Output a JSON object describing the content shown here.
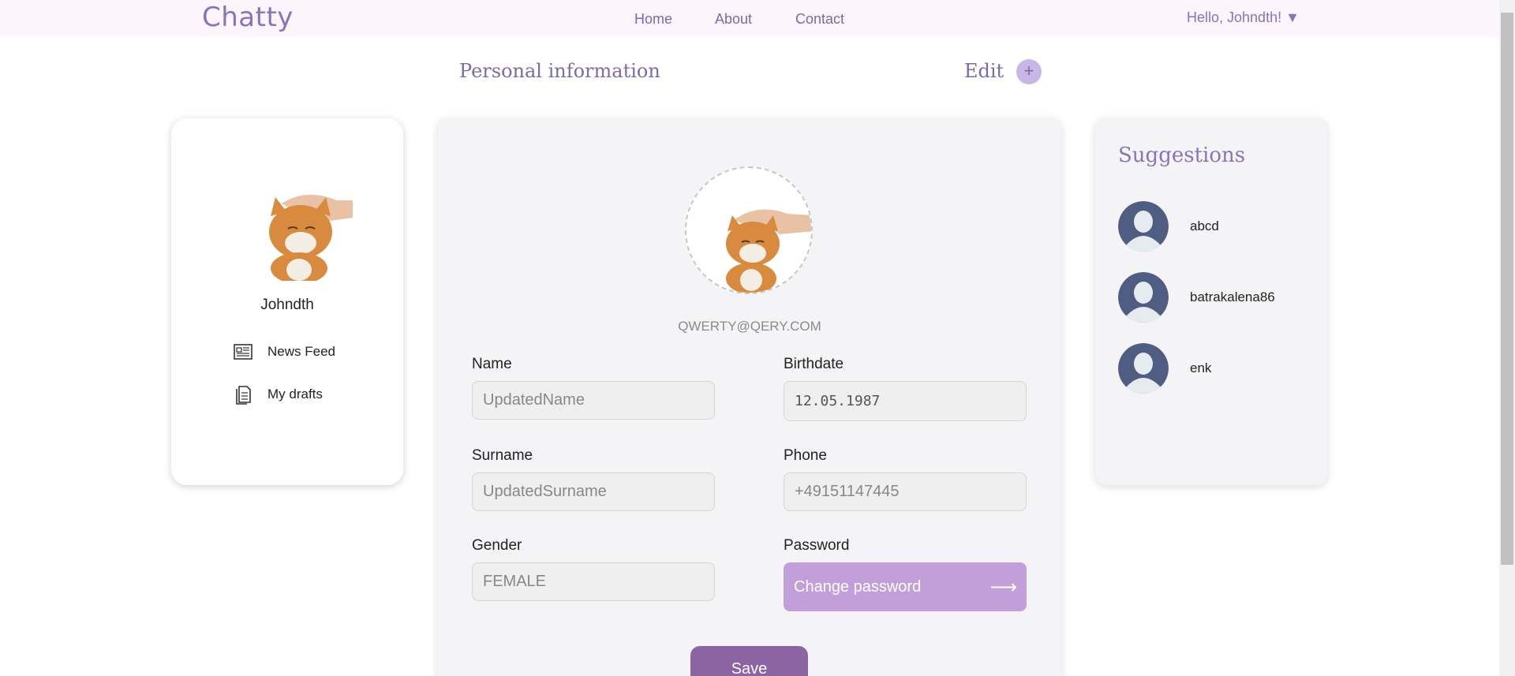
{
  "header": {
    "logo": "Chatty",
    "nav": [
      "Home",
      "About",
      "Contact"
    ],
    "greeting": "Hello, Johndth! ▼"
  },
  "page": {
    "title": "Personal information",
    "edit_label": "Edit",
    "plus": "+"
  },
  "left_card": {
    "username": "Johndth",
    "menu": [
      {
        "label": "News Feed",
        "icon": "newspaper-icon"
      },
      {
        "label": "My drafts",
        "icon": "drafts-icon"
      }
    ]
  },
  "profile": {
    "email": "QWERTY@QERY.COM",
    "name_label": "Name",
    "name_value": "UpdatedName",
    "birthdate_label": "Birthdate",
    "birthdate_value": "12.05.1987",
    "surname_label": "Surname",
    "surname_value": "UpdatedSurname",
    "phone_label": "Phone",
    "phone_value": "+49151147445",
    "gender_label": "Gender",
    "gender_value": "FEMALE",
    "password_label": "Password",
    "change_password": "Change password",
    "arrow": "⟶",
    "save": "Save"
  },
  "suggestions": {
    "title": "Suggestions",
    "users": [
      "abcd",
      "batrakalena86",
      "enk"
    ]
  },
  "colors": {
    "accent": "#8c73b8",
    "header_bg": "#fcf5fb",
    "button": "#c39fda",
    "save": "#8c63a3"
  }
}
